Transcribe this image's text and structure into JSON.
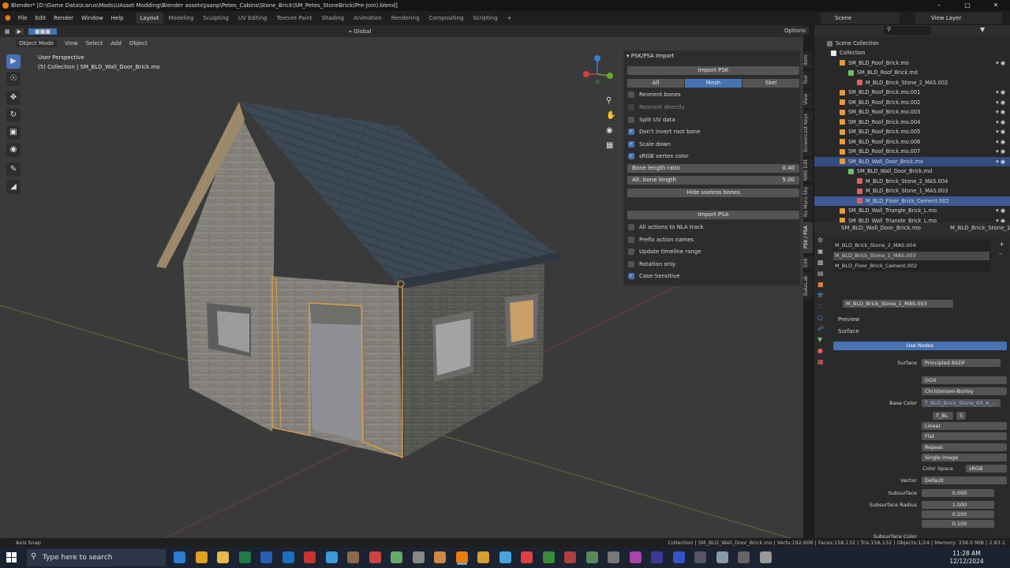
{
  "window": {
    "title": "Blender* [D:\\Game Data\\Icarus\\Mods\\UAsset Modding\\Blender assets\\Jaanp\\Petes_Cabins\\Stone_Brick\\SM_Petes_StoneBrick(Pre-Join).blend]"
  },
  "menu": [
    "File",
    "Edit",
    "Render",
    "Window",
    "Help"
  ],
  "workspace_tabs": [
    "Layout",
    "Modeling",
    "Sculpting",
    "UV Editing",
    "Texture Paint",
    "Shading",
    "Animation",
    "Rendering",
    "Compositing",
    "Scripting"
  ],
  "scene": {
    "name": "Scene",
    "view_layer": "View Layer"
  },
  "viewport": {
    "mode": "Object Mode",
    "menus": [
      "View",
      "Select",
      "Add",
      "Object"
    ],
    "transform": "Global",
    "options": "Options",
    "perspective": "User Perspective",
    "collection_info": "(5) Collection | SM_BLD_Wall_Door_Brick.mo"
  },
  "psk_panel": {
    "header": "PSK/PSA Import",
    "import_psk": "Import PSK",
    "seg": [
      "All",
      "Mesh",
      "Skel"
    ],
    "checks": [
      {
        "label": "Reorient bones",
        "on": false
      },
      {
        "label": "Reorient directly",
        "on": false
      },
      {
        "label": "Split UV data",
        "on": false
      },
      {
        "label": "Don't invert root bone",
        "on": true
      },
      {
        "label": "Scale down",
        "on": true
      },
      {
        "label": "sRGB vertex color",
        "on": true
      }
    ],
    "bone_length_ratio": {
      "label": "Bone length ratio",
      "value": "0.40"
    },
    "alt_bone_length": {
      "label": "Alt. bone length",
      "value": "5.00"
    },
    "hide_useless": "Hide useless bones",
    "import_psa": "Import PSA",
    "psa_checks": [
      {
        "label": "All actions to NLA track",
        "on": false
      },
      {
        "label": "Prefix action names",
        "on": false
      },
      {
        "label": "Update timeline range",
        "on": false
      },
      {
        "label": "Rotation only",
        "on": false
      },
      {
        "label": "Case-Sensitive",
        "on": true
      }
    ]
  },
  "side_tabs": [
    "Item",
    "Tool",
    "View",
    "Screencast Keys",
    "NMS Edit",
    "No Mans Sky",
    "PSK / PSA",
    "Edit",
    "BakeLab"
  ],
  "outliner": {
    "root": "Scene Collection",
    "rows": [
      {
        "label": "Collection",
        "depth": 1,
        "type": "collection"
      },
      {
        "label": "SM_BLD_Roof_Brick.mo",
        "depth": 2,
        "type": "object"
      },
      {
        "label": "SM_BLD_Roof_Brick.md",
        "depth": 3,
        "type": "mesh"
      },
      {
        "label": "M_BLD_Brick_Stone_2_MAS.002",
        "depth": 4,
        "type": "material"
      },
      {
        "label": "SM_BLD_Roof_Brick.mo.001",
        "depth": 2,
        "type": "object"
      },
      {
        "label": "SM_BLD_Roof_Brick.mo.002",
        "depth": 2,
        "type": "object"
      },
      {
        "label": "SM_BLD_Roof_Brick.mo.003",
        "depth": 2,
        "type": "object"
      },
      {
        "label": "SM_BLD_Roof_Brick.mo.004",
        "depth": 2,
        "type": "object"
      },
      {
        "label": "SM_BLD_Roof_Brick.mo.005",
        "depth": 2,
        "type": "object"
      },
      {
        "label": "SM_BLD_Roof_Brick.mo.006",
        "depth": 2,
        "type": "object"
      },
      {
        "label": "SM_BLD_Roof_Brick.mo.007",
        "depth": 2,
        "type": "object"
      },
      {
        "label": "SM_BLD_Wall_Door_Brick.mo",
        "depth": 2,
        "type": "object",
        "selected": true
      },
      {
        "label": "SM_BLD_Wall_Door_Brick.md",
        "depth": 3,
        "type": "mesh"
      },
      {
        "label": "M_BLD_Brick_Stone_2_MAS.004",
        "depth": 4,
        "type": "material"
      },
      {
        "label": "M_BLD_Brick_Stone_1_MAS.003",
        "depth": 4,
        "type": "material"
      },
      {
        "label": "M_BLD_Floor_Brick_Cement.002",
        "depth": 4,
        "type": "material",
        "highlight": true
      },
      {
        "label": "SM_BLD_Wall_Triangle_Brick_L.mo",
        "depth": 2,
        "type": "object"
      },
      {
        "label": "SM_BLD_Wall_Triangle_Brick_L.mo",
        "depth": 2,
        "type": "object"
      }
    ]
  },
  "properties": {
    "object": "SM_BLD_Wall_Door_Brick.mo",
    "material_tab": "M_BLD_Brick_Stone_1_M",
    "slots": [
      "M_BLD_Brick_Stone_2_MAS.004",
      "M_BLD_Brick_Stone_1_MAS.003",
      "M_BLD_Floor_Brick_Cement.002"
    ],
    "active_material": "M_BLD_Brick_Stone_1_MAS.003",
    "preview": "Preview",
    "surface_section": "Surface",
    "use_nodes": "Use Nodes",
    "surface_label": "Surface",
    "surface_value": "Principled BSDF",
    "dist": "GGX",
    "sss": "Christensen-Burley",
    "base_color_label": "Base Color",
    "base_color_value": "T_BLD_Brick_Stone_Kit_A_...",
    "image_name": "T_BL",
    "image_users": "5",
    "interp": "Linear",
    "proj": "Flat",
    "ext": "Repeat",
    "source": "Single Image",
    "colorspace_label": "Color Space",
    "colorspace_value": "sRGB",
    "vector_label": "Vector",
    "vector_value": "Default",
    "subsurface_label": "Subsurface",
    "subsurface_value": "0.000",
    "sss_radius_label": "Subsurface Radius",
    "sss_radius": [
      "1.000",
      "0.200",
      "0.100"
    ],
    "sss_color_label": "Subsurface Color"
  },
  "status": {
    "left": "Axis Snap",
    "right": "Collection | SM_BLD_Wall_Door_Brick.mo | Verts:192,606 | Faces:158,132 | Tris:158,132 | Objects:1/24 | Memory: 338.0 MiB | 2.83.1"
  },
  "taskbar": {
    "search_placeholder": "Type here to search",
    "time": "11:28 AM",
    "date": "12/12/2024"
  },
  "colors": {
    "accent": "#4772b3",
    "selected_orange": "#e8a040",
    "roof": "#3b4650",
    "brick": "#6b6b66"
  }
}
